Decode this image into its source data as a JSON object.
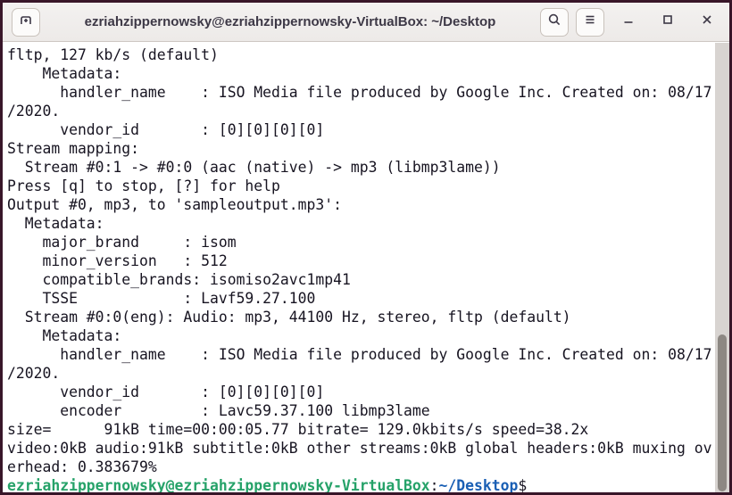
{
  "window": {
    "title": "ezriahzippernowsky@ezriahzippernowsky-VirtualBox: ~/Desktop",
    "buttons": {
      "new_tab_icon": "new-tab-plus",
      "search_icon": "magnifier",
      "menu_icon": "hamburger",
      "minimize_icon": "dash",
      "maximize_icon": "square-outline",
      "close_icon": "x-cross"
    }
  },
  "colors": {
    "window_border": "#381629",
    "titlebar_bg": "#f0eeec",
    "terminal_bg": "#ffffff",
    "terminal_fg": "#171421",
    "prompt_green": "#26a269",
    "prompt_blue": "#1a5fb4",
    "scrollbar_track": "#d8d4d1",
    "scrollbar_thumb": "#8d8883"
  },
  "terminal": {
    "columns": 80,
    "lines": [
      "fltp, 127 kb/s (default)",
      "    Metadata:",
      "      handler_name    : ISO Media file produced by Google Inc. Created on: 08/17",
      "/2020.",
      "      vendor_id       : [0][0][0][0]",
      "Stream mapping:",
      "  Stream #0:1 -> #0:0 (aac (native) -> mp3 (libmp3lame))",
      "Press [q] to stop, [?] for help",
      "Output #0, mp3, to 'sampleoutput.mp3':",
      "  Metadata:",
      "    major_brand     : isom",
      "    minor_version   : 512",
      "    compatible_brands: isomiso2avc1mp41",
      "    TSSE            : Lavf59.27.100",
      "  Stream #0:0(eng): Audio: mp3, 44100 Hz, stereo, fltp (default)",
      "    Metadata:",
      "      handler_name    : ISO Media file produced by Google Inc. Created on: 08/17",
      "/2020.",
      "      vendor_id       : [0][0][0][0]",
      "      encoder         : Lavc59.37.100 libmp3lame",
      "size=      91kB time=00:00:05.77 bitrate= 129.0kbits/s speed=38.2x",
      "video:0kB audio:91kB subtitle:0kB other streams:0kB global headers:0kB muxing ov",
      "erhead: 0.383679%"
    ],
    "prompt": {
      "user_host": "ezriahzippernowsky@ezriahzippernowsky-VirtualBox",
      "colon": ":",
      "path": "~/Desktop",
      "dollar": "$"
    }
  }
}
